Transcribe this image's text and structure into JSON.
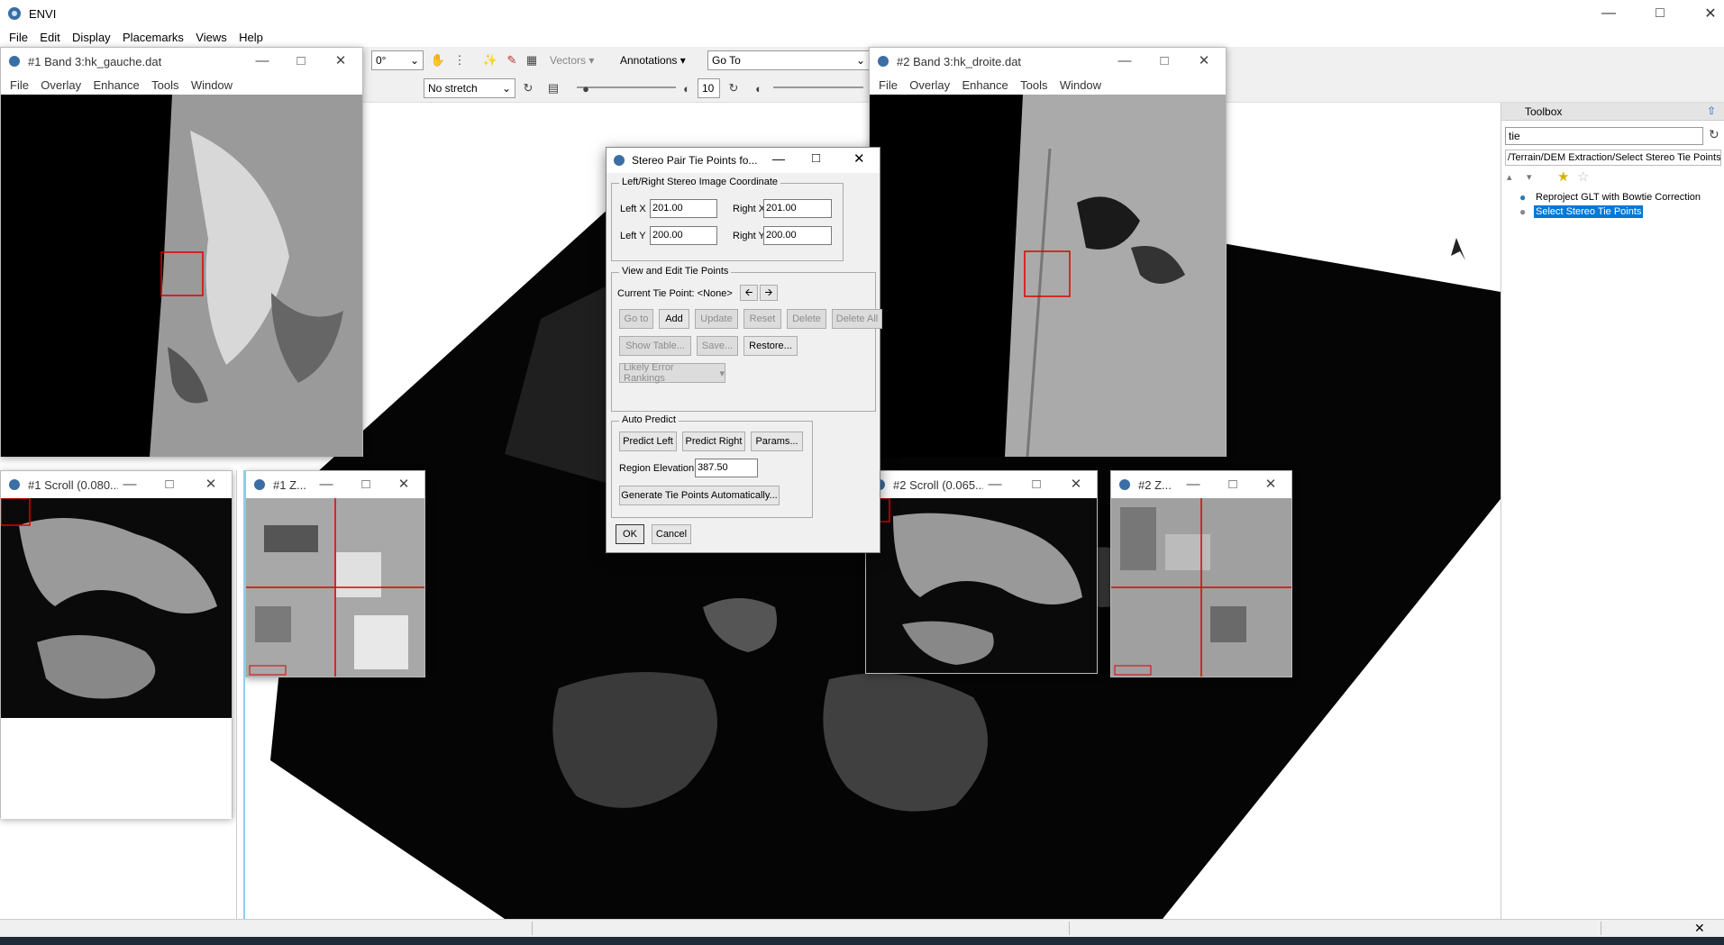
{
  "app": {
    "title": "ENVI"
  },
  "menu": [
    "File",
    "Edit",
    "Display",
    "Placemarks",
    "Views",
    "Help"
  ],
  "toolbar": {
    "rotation": "0°",
    "vectors": "Vectors",
    "annotations": "Annotations",
    "goto": "Go To",
    "stretch": "No stretch",
    "sharpen_value": "10"
  },
  "windows": {
    "band1": {
      "title": "#1 Band 3:hk_gauche.dat",
      "menu": [
        "File",
        "Overlay",
        "Enhance",
        "Tools",
        "Window"
      ]
    },
    "band2": {
      "title": "#2 Band 3:hk_droite.dat",
      "menu": [
        "File",
        "Overlay",
        "Enhance",
        "Tools",
        "Window"
      ]
    },
    "scroll1": {
      "title": "#1 Scroll (0.080..."
    },
    "zoom1": {
      "title": "#1 Z..."
    },
    "scroll2": {
      "title": "#2 Scroll (0.065..."
    },
    "zoom2": {
      "title": "#2 Z..."
    }
  },
  "dialog": {
    "title": "Stereo Pair Tie Points fo...",
    "coord_group": "Left/Right Stereo Image Coordinate",
    "left_x_label": "Left X",
    "left_x": "201.00",
    "right_x_label": "Right X",
    "right_x": "201.00",
    "left_y_label": "Left Y",
    "left_y": "200.00",
    "right_y_label": "Right Y",
    "right_y": "200.00",
    "edit_group": "View and Edit Tie Points",
    "current_tie": "Current Tie Point: <None>",
    "btn_goto": "Go to",
    "btn_add": "Add",
    "btn_update": "Update",
    "btn_reset": "Reset",
    "btn_delete": "Delete",
    "btn_delete_all": "Delete All",
    "btn_show_table": "Show Table...",
    "btn_save": "Save...",
    "btn_restore": "Restore...",
    "error_rankings": "Likely Error Rankings",
    "auto_group": "Auto Predict",
    "btn_predict_left": "Predict Left",
    "btn_predict_right": "Predict Right",
    "btn_params": "Params...",
    "region_elev_label": "Region Elevation",
    "region_elev": "387.50",
    "btn_generate": "Generate Tie Points Automatically...",
    "btn_ok": "OK",
    "btn_cancel": "Cancel"
  },
  "toolbox": {
    "title": "Toolbox",
    "search_value": "tie",
    "path": "/Terrain/DEM Extraction/Select Stereo Tie Points",
    "items": [
      "Reproject GLT with Bowtie Correction",
      "Select Stereo Tie Points"
    ]
  },
  "colors": {
    "accent": "#0078d7",
    "crosshair": "#e00000"
  }
}
